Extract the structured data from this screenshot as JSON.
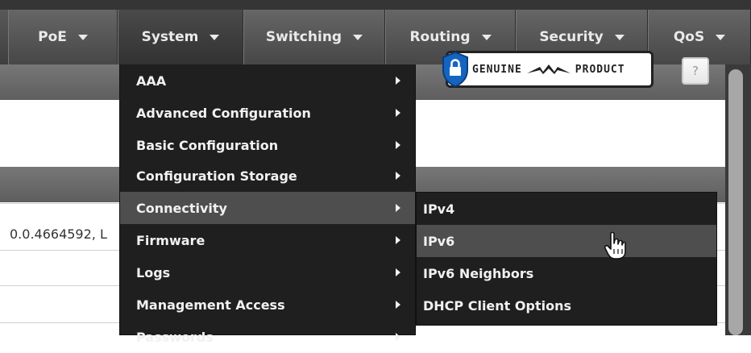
{
  "nav": {
    "tabs": [
      {
        "label": "PoE"
      },
      {
        "label": "System"
      },
      {
        "label": "Switching"
      },
      {
        "label": "Routing"
      },
      {
        "label": "Security"
      },
      {
        "label": "QoS"
      }
    ]
  },
  "system_menu": {
    "items": [
      {
        "label": "AAA"
      },
      {
        "label": "Advanced Configuration"
      },
      {
        "label": "Basic Configuration"
      },
      {
        "label": "Configuration Storage"
      },
      {
        "label": "Connectivity"
      },
      {
        "label": "Firmware"
      },
      {
        "label": "Logs"
      },
      {
        "label": "Management Access"
      },
      {
        "label": "Passwords"
      }
    ]
  },
  "connectivity_submenu": {
    "items": [
      {
        "label": "IPv4"
      },
      {
        "label": "IPv6"
      },
      {
        "label": "IPv6 Neighbors"
      },
      {
        "label": "DHCP Client Options"
      }
    ]
  },
  "main": {
    "partial_row_text": "0.0.4664592, L",
    "genuine_badge": {
      "left": "GENUINE",
      "right": "PRODUCT"
    },
    "help_label": "?"
  },
  "colors": {
    "menu_bg": "#1f1f1f",
    "menu_highlight": "#4e4e4e",
    "nav_bg": "#4a4a4a"
  },
  "icons": {
    "caret": "caret-down-icon",
    "submenu_arrow": "caret-right-icon",
    "cursor": "hand-pointer-icon",
    "badge": "shield-lock-icon"
  }
}
